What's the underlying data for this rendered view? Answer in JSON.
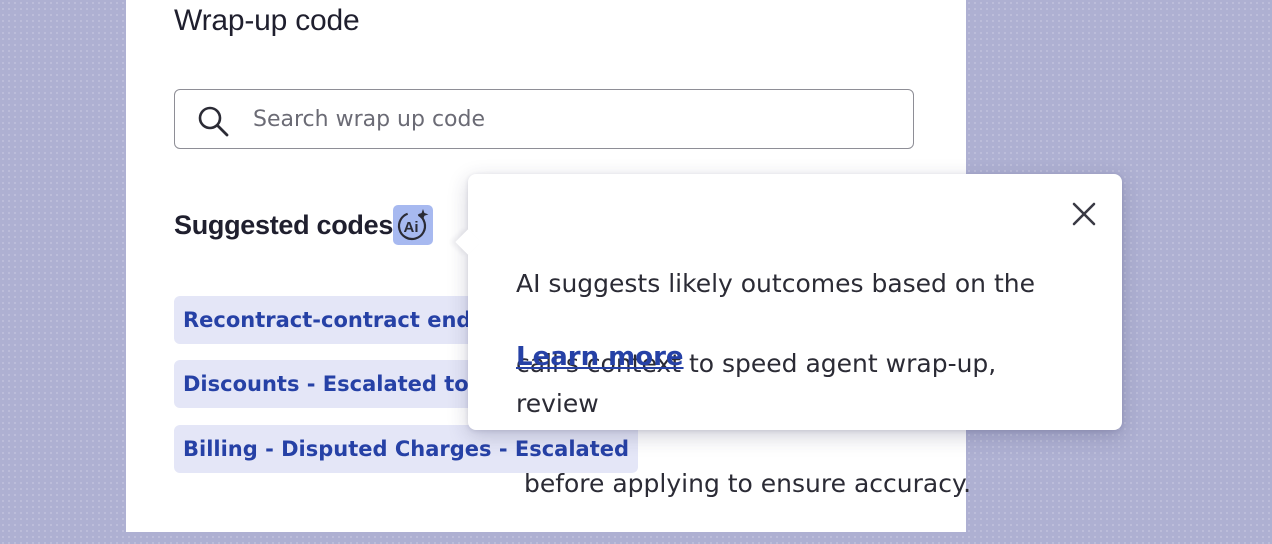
{
  "panel": {
    "title": "Wrap-up code",
    "search": {
      "placeholder": "Search wrap up code",
      "value": "",
      "icon": "search-icon"
    },
    "suggested": {
      "title": "Suggested codes",
      "ai_icon": "ai-sparkle-icon",
      "codes": [
        {
          "label": "Recontract-contract end-d"
        },
        {
          "label": "Discounts - Escalated to TL"
        },
        {
          "label": "Billing - Disputed Charges - Escalated"
        }
      ]
    }
  },
  "popover": {
    "text_lines": [
      "AI suggests likely outcomes based on the",
      "call's context to speed agent wrap-up, review",
      " before applying to ensure accuracy."
    ],
    "learn_more": "Learn more",
    "close_icon": "close-icon"
  },
  "colors": {
    "background": "#aeb0d2",
    "panel": "#ffffff",
    "chip_bg": "#e4e6f7",
    "chip_text": "#2641a6",
    "ai_badge": "#a7b9f0",
    "link": "#2641a6"
  }
}
